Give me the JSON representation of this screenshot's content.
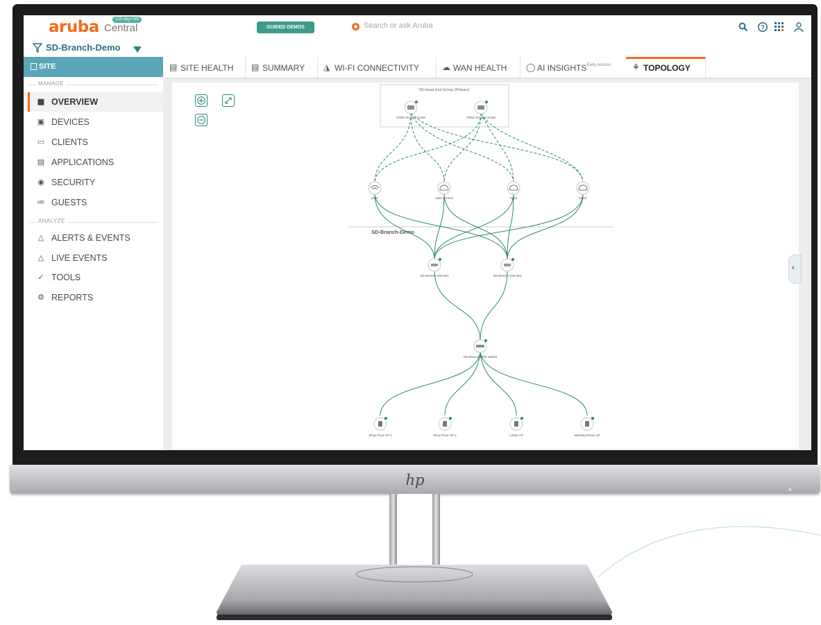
{
  "brand": {
    "name": "aruba",
    "product": "Central",
    "badge": "105 days left"
  },
  "header": {
    "guided_demos": "GUIDED DEMOS",
    "search_placeholder": "Search or ask Aruba",
    "icons": [
      "search-icon",
      "help-icon",
      "apps-grid-icon",
      "user-icon"
    ]
  },
  "site_filter": {
    "label": "SD-Branch-Demo"
  },
  "sidebar": {
    "head": "SITE",
    "sections": {
      "manage": "MANAGE",
      "analyze": "ANALYZE"
    },
    "manage_items": [
      {
        "label": "OVERVIEW",
        "icon": "overview-grid-icon",
        "active": true
      },
      {
        "label": "DEVICES",
        "icon": "devices-icon"
      },
      {
        "label": "CLIENTS",
        "icon": "clients-icon"
      },
      {
        "label": "APPLICATIONS",
        "icon": "applications-icon"
      },
      {
        "label": "SECURITY",
        "icon": "security-icon"
      },
      {
        "label": "GUESTS",
        "icon": "guests-icon"
      }
    ],
    "analyze_items": [
      {
        "label": "ALERTS & EVENTS",
        "icon": "bell-icon"
      },
      {
        "label": "LIVE EVENTS",
        "icon": "bell-icon"
      },
      {
        "label": "TOOLS",
        "icon": "tools-icon"
      },
      {
        "label": "REPORTS",
        "icon": "reports-icon"
      }
    ]
  },
  "tabs": [
    {
      "label": "SITE HEALTH",
      "icon": "site-health-icon"
    },
    {
      "label": "SUMMARY",
      "icon": "summary-icon"
    },
    {
      "label": "WI-FI CONNECTIVITY",
      "icon": "wifi-connectivity-icon"
    },
    {
      "label": "WAN HEALTH",
      "icon": "cloud-icon"
    },
    {
      "label": "AI INSIGHTS",
      "sup": "Early Access",
      "icon": "lightbulb-icon"
    },
    {
      "label": "TOPOLOGY",
      "icon": "topology-icon",
      "active": true
    }
  ],
  "topology": {
    "head_end_group": "SD-Head End Group (Primary)",
    "vpnc_nodes": [
      "VPNC-RAM-1-South",
      "VPNC-RAM-2-South"
    ],
    "wan_nodes": [
      "airlte",
      "mpls-verizon",
      "isp01",
      "isp02"
    ],
    "site_name": "SD-Branch-Demo",
    "gateways": [
      "SD-Branch-GW-001",
      "SD-Branch-GW-002"
    ],
    "switch": "SD-Branch-POE-Switch",
    "access_points": [
      "Shop Floor AP 1",
      "Shop Floor AP 2",
      "Lobby AP",
      "Meeting Room AP"
    ]
  },
  "colors": {
    "accent": "#f26b21",
    "teal": "#2b8a76",
    "site_head": "#5aa5b6",
    "link": "#2b8a76"
  }
}
